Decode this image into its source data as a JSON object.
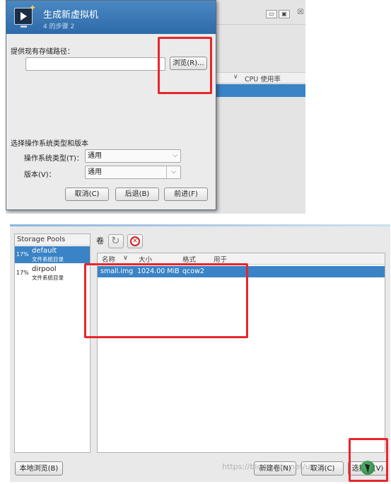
{
  "top": {
    "dialog": {
      "title": "生成新虚拟机",
      "step": "4 的步骤 2",
      "storage_label": "提供现有存储路径：",
      "path_value": "",
      "browse_button": "浏览(R)...",
      "os_section_label": "选择操作系统类型和版本",
      "os_type_label": "操作系统类型(T)：",
      "os_type_value": "通用",
      "version_label": "版本(V)：",
      "version_value": "通用",
      "cancel_button": "取消(C)",
      "back_button": "后退(B)",
      "forward_button": "前进(F)"
    },
    "background_window": {
      "minimize": "▭",
      "maximize": "▣",
      "close": "☒",
      "column_header": "CPU 使用率",
      "sort_glyph": "∨"
    }
  },
  "bottom": {
    "pools_header": "Storage Pools",
    "pools": [
      {
        "pct": "17%",
        "name": "default",
        "desc": "文件系统目录"
      },
      {
        "pct": "17%",
        "name": "dirpool",
        "desc": "文件系统目录"
      }
    ],
    "volumes_label": "卷",
    "columns": {
      "name": "名称",
      "sort": "∨",
      "size": "大小",
      "format": "格式",
      "used": "用于"
    },
    "volumes": [
      {
        "name": "small.img",
        "size": "1024.00 MiB",
        "format": "qcow2",
        "used": ""
      }
    ],
    "local_browse_button": "本地浏览(B)",
    "new_volume_button": "新建卷(N)",
    "cancel_button": "取消(C)",
    "choose_button": "选择卷(V)",
    "watermark": "https://blog.csdn.net/u..."
  },
  "colors": {
    "accent": "#3a83c6",
    "highlight_box": "#e8262b",
    "dialog_header": "#2d6aa8"
  }
}
